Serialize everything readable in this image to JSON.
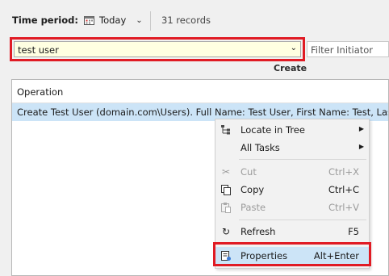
{
  "toolbar": {
    "time_period_label": "Time period:",
    "time_period_value": "Today",
    "records": "31 records"
  },
  "filter": {
    "value": "test user",
    "initiator_placeholder": "Filter Initiator",
    "create_label": "Create"
  },
  "grid": {
    "header": "Operation",
    "rows": [
      "Create Test User (domain.com\\Users). Full Name: Test User, First Name: Test, Last Name: User"
    ]
  },
  "context_menu": {
    "items": [
      {
        "label": "Locate in Tree",
        "shortcut": "",
        "submenu": true,
        "enabled": true,
        "icon": "locate-tree-icon"
      },
      {
        "label": "All Tasks",
        "shortcut": "",
        "submenu": true,
        "enabled": true,
        "icon": ""
      },
      {
        "label": "Cut",
        "shortcut": "Ctrl+X",
        "enabled": false,
        "icon": "scissors-icon"
      },
      {
        "label": "Copy",
        "shortcut": "Ctrl+C",
        "enabled": true,
        "icon": "copy-icon"
      },
      {
        "label": "Paste",
        "shortcut": "Ctrl+V",
        "enabled": false,
        "icon": "paste-icon"
      },
      {
        "label": "Refresh",
        "shortcut": "F5",
        "enabled": true,
        "icon": "refresh-icon"
      },
      {
        "label": "Properties",
        "shortcut": "Alt+Enter",
        "enabled": true,
        "highlighted": true,
        "icon": "properties-icon"
      }
    ]
  },
  "colors": {
    "highlight_border": "#e01b24",
    "selection": "#cce4f7",
    "filter_background": "#ffffe1"
  }
}
